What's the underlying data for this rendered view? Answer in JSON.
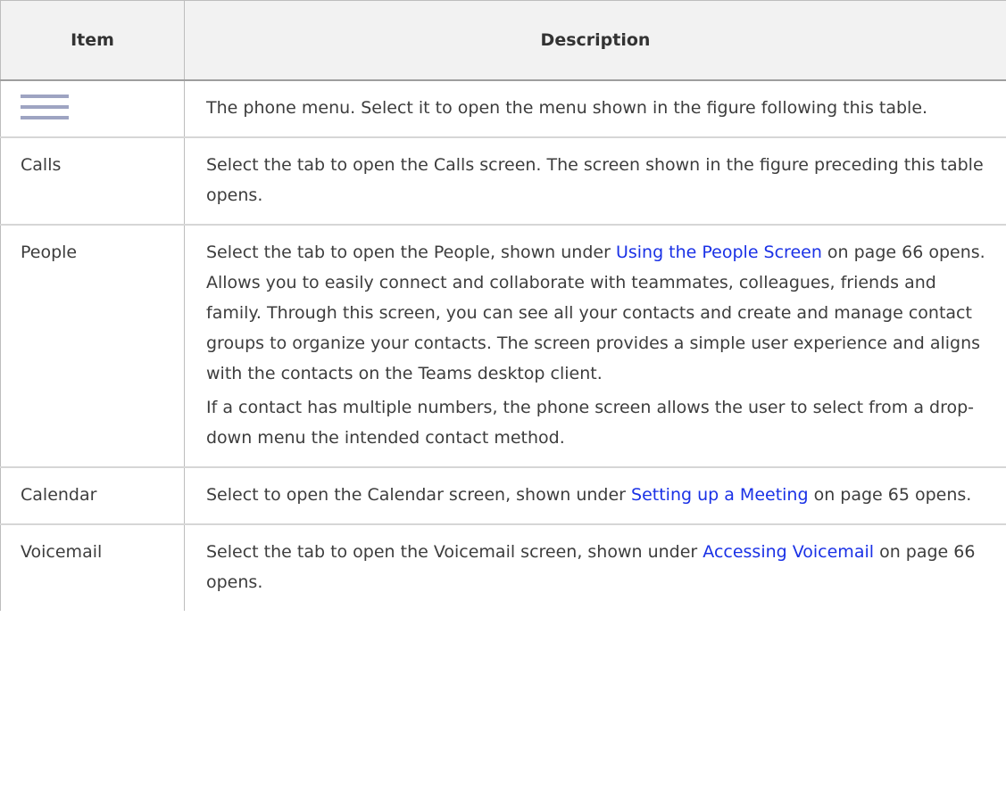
{
  "table": {
    "headers": {
      "item": "Item",
      "description": "Description"
    },
    "rows": [
      {
        "item_icon": "hamburger-menu-icon",
        "description": [
          {
            "text": "The phone menu. Select it to open the menu shown in the figure following this table."
          }
        ]
      },
      {
        "item": "Calls",
        "description": [
          {
            "text": "Select the tab to open the Calls screen. The screen shown in the figure preceding this table opens."
          }
        ]
      },
      {
        "item": "People",
        "description": [
          {
            "before": "Select the tab to open the People, shown under ",
            "link": "Using the People Screen",
            "after": " on page 66 opens. Allows you to easily connect and collaborate with teammates, colleagues, friends and family. Through this screen, you can see all your contacts and create and manage contact groups to organize your contacts. The screen provides a simple user experience and aligns with the contacts on the Teams desktop client."
          },
          {
            "text": "If a contact has multiple numbers, the phone screen allows the user to select from a drop-down menu the intended contact method."
          }
        ]
      },
      {
        "item": "Calendar",
        "description": [
          {
            "before": "Select to open the Calendar screen, shown under ",
            "link": "Setting up a Meeting",
            "after": " on page 65 opens."
          }
        ]
      },
      {
        "item": "Voicemail",
        "description": [
          {
            "before": "Select the tab to open the Voicemail screen, shown under ",
            "link": "Accessing Voicemail",
            "after": " on page 66 opens."
          }
        ]
      }
    ]
  },
  "colors": {
    "link": "#1a31e6",
    "header_bg": "#f2f2f2",
    "icon": "#9ea4c2"
  }
}
